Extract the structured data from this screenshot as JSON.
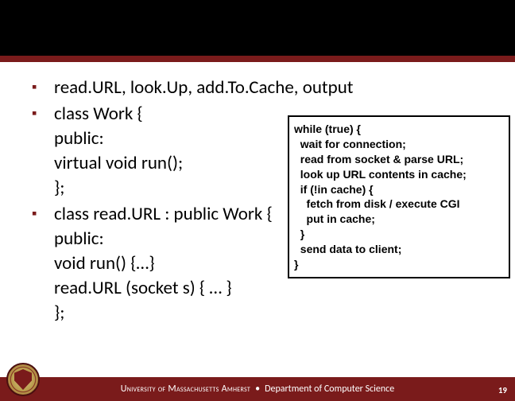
{
  "bullets": {
    "b1": "read.URL, look.Up, add.To.Cache, output",
    "b2_l1": "class Work {",
    "b2_l2": "public:",
    "b2_l3": " virtual void run();",
    "b2_l4": "};",
    "b3_l1": "class read.URL : public Work {",
    "b3_l2": "public:",
    "b3_l3": " void run() {…}",
    "b3_l4": " read.URL (socket s) { … }",
    "b3_l5": "};"
  },
  "codebox": "while (true) {\n  wait for connection;\n  read from socket & parse URL;\n  look up URL contents in cache;\n  if (!in cache) {\n    fetch from disk / execute CGI\n    put in cache;\n  }\n  send data to client;\n}",
  "footer": {
    "university": "University of Massachusetts Amherst",
    "separator": "•",
    "dept": "Department of Computer Science",
    "page": "19"
  }
}
